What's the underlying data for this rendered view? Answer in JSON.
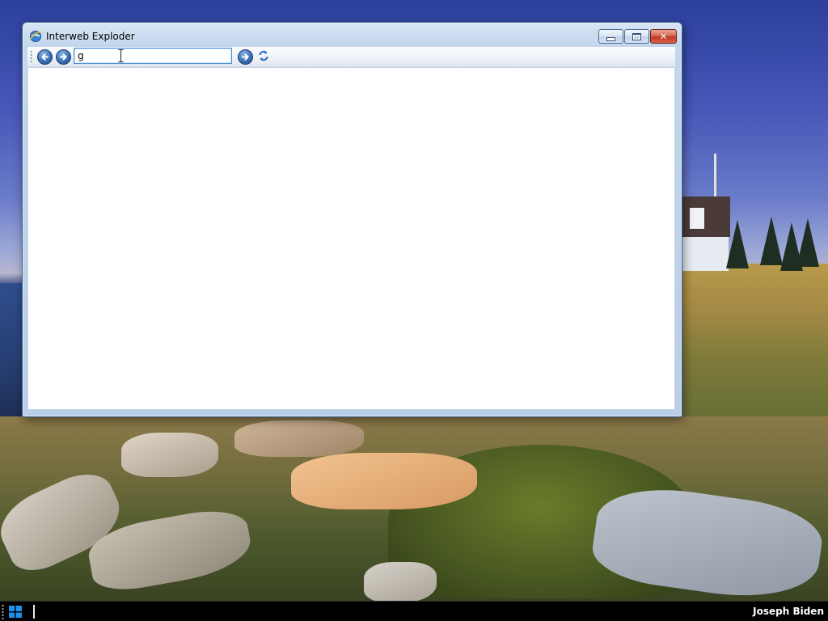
{
  "window": {
    "title": "Interweb Exploder",
    "icon": "browser-logo-icon"
  },
  "toolbar": {
    "address_value": "g",
    "back_icon": "back-arrow-icon",
    "forward_icon": "forward-arrow-icon",
    "go_icon": "go-arrow-icon",
    "refresh_icon": "refresh-icon"
  },
  "taskbar": {
    "start_icon": "windows-logo-icon",
    "user_name": "Joseph Biden"
  },
  "colors": {
    "window_frame": "#b9cee8",
    "address_border": "#4d8fd6",
    "close_button": "#c2371e",
    "taskbar": "#000000"
  }
}
